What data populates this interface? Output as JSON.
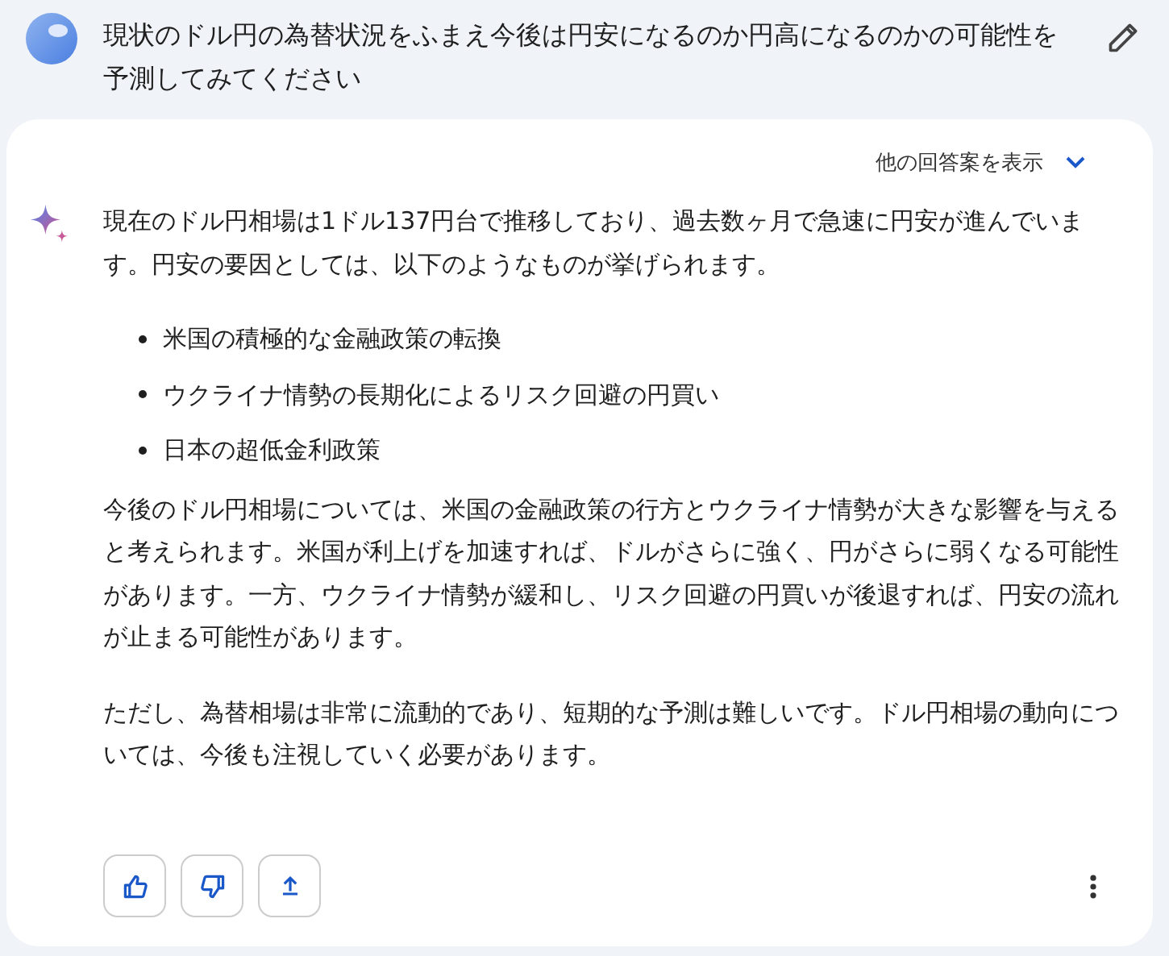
{
  "prompt": {
    "text": "現状のドル円の為替状況をふまえ今後は円安になるのか円高になるのかの可能性を予測してみてください"
  },
  "response": {
    "other_drafts": "他の回答案を表示",
    "paragraphs": [
      {
        "kind": "text",
        "text": "現在のドル円相場は1ドル137円台で推移しており、過去数ヶ月で急速に円安が進んでいます。円安の要因としては、以下のようなものが挙げられます。"
      },
      {
        "kind": "list",
        "items": [
          "米国の積極的な金融政策の転換",
          "ウクライナ情勢の長期化によるリスク回避の円買い",
          "日本の超低金利政策"
        ]
      },
      {
        "kind": "text",
        "text": "今後のドル円相場については、米国の金融政策の行方とウクライナ情勢が大きな影響を与えると考えられます。米国が利上げを加速すれば、ドルがさらに強く、円がさらに弱くなる可能性があります。一方、ウクライナ情勢が緩和し、リスク回避の円買いが後退すれば、円安の流れが止まる可能性があります。"
      },
      {
        "kind": "text",
        "text": "ただし、為替相場は非常に流動的であり、短期的な予測は難しいです。ドル円相場の動向については、今後も注視していく必要があります。"
      }
    ]
  }
}
